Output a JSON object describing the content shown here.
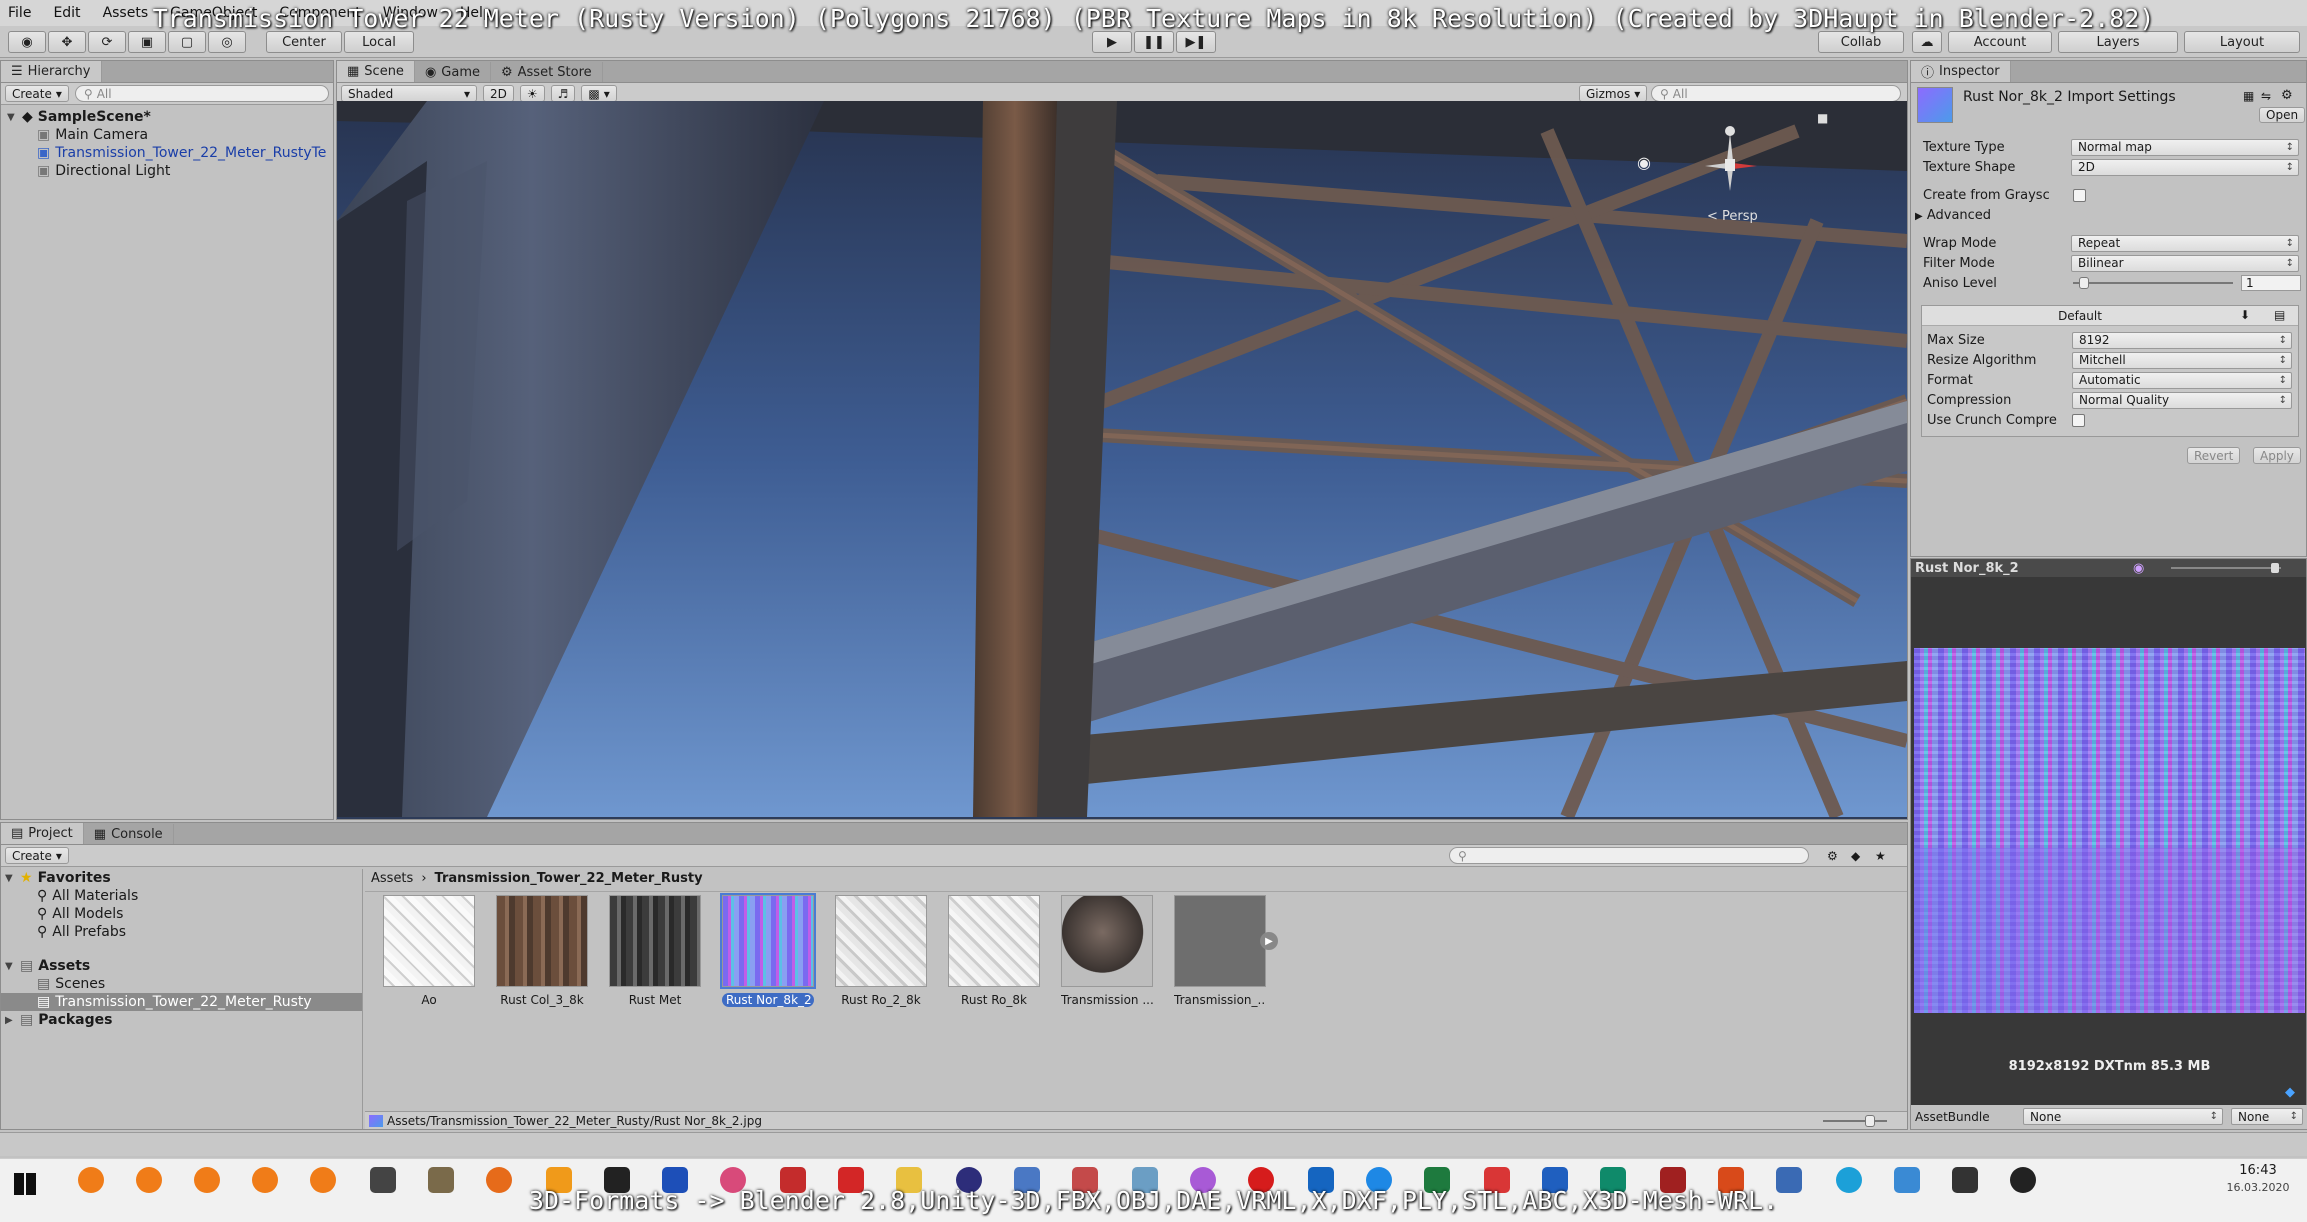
{
  "overlay": {
    "title": "Transmission Tower 22 Meter (Rusty Version) (Polygons 21768) (PBR Texture Maps in 8k Resolution) (Created by 3DHaupt in Blender-2.82)",
    "bottom": "3D-Formats -> Blender 2.8,Unity-3D,FBX,OBJ,DAE,VRML,X,DXF,PLY,STL,ABC,X3D-Mesh-WRL."
  },
  "menu": [
    "File",
    "Edit",
    "Assets",
    "GameObject",
    "Component",
    "Window",
    "Help"
  ],
  "toolbar": {
    "pivot": "Center",
    "space": "Local",
    "collab": "Collab",
    "account": "Account",
    "layers": "Layers",
    "layout": "Layout"
  },
  "hierarchy": {
    "tab": "Hierarchy",
    "create": "Create",
    "search_placeholder": "All",
    "scene": "SampleScene*",
    "items": [
      "Main Camera",
      "Transmission_Tower_22_Meter_RustyTe",
      "Directional Light"
    ]
  },
  "scene_view": {
    "tabs": [
      "Scene",
      "Game",
      "Asset Store"
    ],
    "shading": "Shaded",
    "mode_2d": "2D",
    "gizmos": "Gizmos",
    "search_placeholder": "All",
    "persp": "< Persp"
  },
  "inspector": {
    "tab": "Inspector",
    "asset_title": "Rust Nor_8k_2 Import Settings",
    "open": "Open",
    "texture_type_label": "Texture Type",
    "texture_type": "Normal map",
    "texture_shape_label": "Texture Shape",
    "texture_shape": "2D",
    "create_from_grayscale": "Create from Graysc",
    "advanced": "Advanced",
    "wrap_mode_label": "Wrap Mode",
    "wrap_mode": "Repeat",
    "filter_mode_label": "Filter Mode",
    "filter_mode": "Bilinear",
    "aniso_label": "Aniso Level",
    "aniso_value": "1",
    "platform_tab": "Default",
    "max_size_label": "Max Size",
    "max_size": "8192",
    "resize_label": "Resize Algorithm",
    "resize": "Mitchell",
    "format_label": "Format",
    "format": "Automatic",
    "compression_label": "Compression",
    "compression": "Normal Quality",
    "crunch_label": "Use Crunch Compre",
    "revert": "Revert",
    "apply": "Apply"
  },
  "preview": {
    "title": "Rust Nor_8k_2",
    "info": "8192x8192  DXTnm   85.3 MB",
    "assetbundle_label": "AssetBundle",
    "assetbundle": "None",
    "variant": "None"
  },
  "project": {
    "tabs": [
      "Project",
      "Console"
    ],
    "create": "Create",
    "favorites": "Favorites",
    "favorites_items": [
      "All Materials",
      "All Models",
      "All Prefabs"
    ],
    "assets": "Assets",
    "asset_folders": [
      "Scenes",
      "Transmission_Tower_22_Meter_Rusty"
    ],
    "packages": "Packages",
    "breadcrumb": [
      "Assets",
      "Transmission_Tower_22_Meter_Rusty"
    ],
    "thumbs": [
      "Ao",
      "Rust Col_3_8k",
      "Rust Met",
      "Rust Nor_8k_2",
      "Rust Ro_2_8k",
      "Rust Ro_8k",
      "Transmission ...",
      "Transmission_..."
    ],
    "path": "Assets/Transmission_Tower_22_Meter_Rusty/Rust Nor_8k_2.jpg"
  },
  "taskbar": {
    "time": "16:43",
    "date": "16.03.2020"
  }
}
